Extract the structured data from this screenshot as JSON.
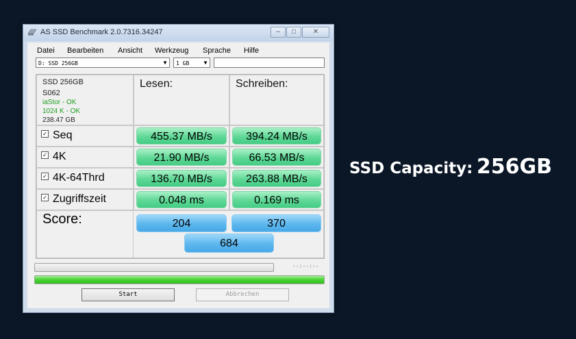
{
  "window": {
    "title": "AS SSD Benchmark 2.0.7316.34247",
    "buttons": {
      "minimize": "–",
      "maximize": "□",
      "close": "✕"
    }
  },
  "menu": [
    "Datei",
    "Bearbeiten",
    "Ansicht",
    "Werkzeug",
    "Sprache",
    "Hilfe"
  ],
  "drive_select": {
    "value": "D: SSD 256GB"
  },
  "size_select": {
    "value": "1 GB"
  },
  "extra_field": {
    "value": ""
  },
  "drive_info": {
    "name": "SSD 256GB",
    "firmware": "S062",
    "driver": "iaStor - OK",
    "alignment": "1024 K - OK",
    "capacity": "238.47 GB"
  },
  "headers": {
    "read": "Lesen:",
    "write": "Schreiben:"
  },
  "tests": [
    {
      "label": "Seq",
      "checked": "✓",
      "read": "455.37 MB/s",
      "write": "394.24 MB/s"
    },
    {
      "label": "4K",
      "checked": "✓",
      "read": "21.90 MB/s",
      "write": "66.53 MB/s"
    },
    {
      "label": "4K-64Thrd",
      "checked": "✓",
      "read": "136.70 MB/s",
      "write": "263.88 MB/s"
    },
    {
      "label": "Zugriffszeit",
      "checked": "✓",
      "read": "0.048 ms",
      "write": "0.169 ms"
    }
  ],
  "score": {
    "label": "Score:",
    "read": "204",
    "write": "370",
    "total": "684"
  },
  "progress": {
    "time_text": "--:--:--",
    "overall_fraction": 1.0
  },
  "buttons": {
    "start": "Start",
    "abort": "Abbrechen"
  },
  "caption": {
    "label": "SSD Capacity:",
    "value": "256GB"
  },
  "colors": {
    "result_green": "#5fd896",
    "score_blue": "#5db7ee",
    "ok_green": "#1f9d1f",
    "background": "#0b1727"
  },
  "icons": {
    "app": "drive-icon",
    "check": "checkmark-icon"
  }
}
